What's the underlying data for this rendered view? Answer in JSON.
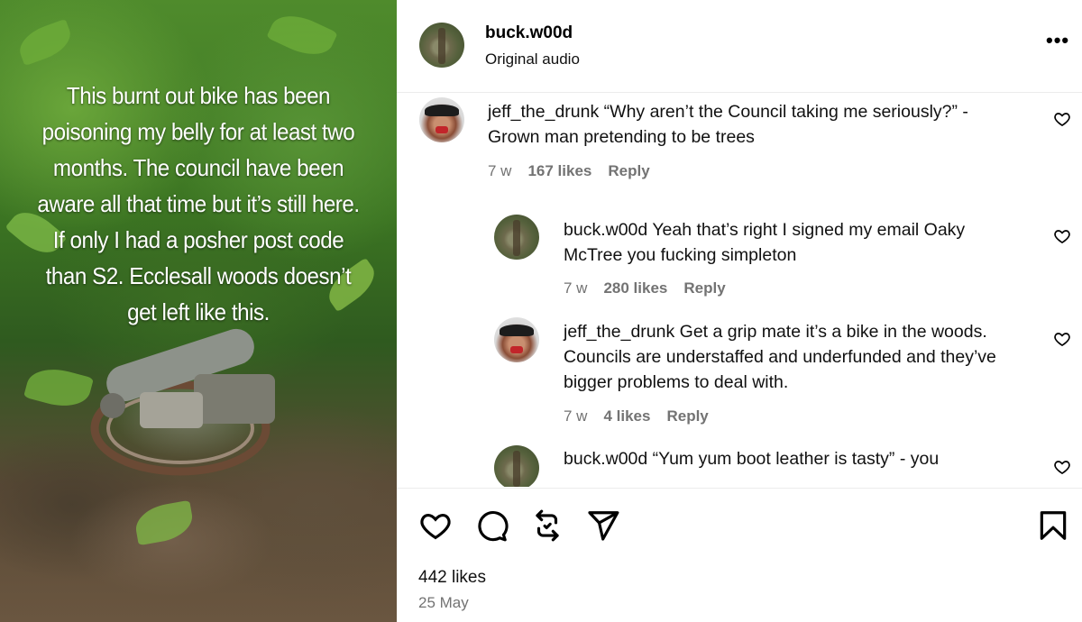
{
  "media": {
    "caption": "This burnt out bike has been poisoning my belly for at least two months. The council have been aware all that time but it’s still here. If only I had a posher post code than S2. Ecclesall woods doesn’t get left like this."
  },
  "header": {
    "username": "buck.w00d",
    "audio": "Original audio",
    "more_icon": "more-options-icon",
    "more_label": "•••"
  },
  "comments": [
    {
      "username": "jeff_the_drunk",
      "text": "“Why aren’t the Council taking me seriously?” - Grown man pretending to be trees",
      "time": "7 w",
      "likes": "167 likes",
      "reply": "Reply",
      "avatar": "man-avatar"
    },
    {
      "username": "buck.w00d",
      "text": "Yeah that’s right I signed my email Oaky McTree you fucking simpleton",
      "time": "7 w",
      "likes": "280 likes",
      "reply": "Reply",
      "avatar": "tree-avatar"
    },
    {
      "username": "jeff_the_drunk",
      "text": "Get a grip mate it’s a bike in the woods. Councils are understaffed and underfunded and they’ve bigger problems to deal with.",
      "time": "7 w",
      "likes": "4 likes",
      "reply": "Reply",
      "avatar": "man-avatar"
    },
    {
      "username": "buck.w00d",
      "text": "“Yum yum boot leather is tasty” - you",
      "avatar": "tree-avatar"
    }
  ],
  "actions": {
    "icons": [
      "heart-icon",
      "comment-icon",
      "repost-icon",
      "share-icon",
      "bookmark-icon"
    ]
  },
  "post": {
    "likes": "442 likes",
    "date": "25 May"
  }
}
